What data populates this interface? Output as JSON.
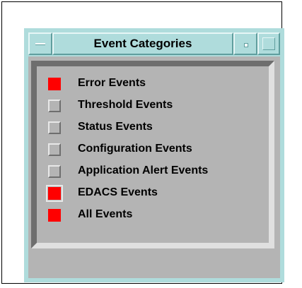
{
  "window": {
    "title": "Event Categories"
  },
  "categories": [
    {
      "label": "Error Events",
      "checked": true
    },
    {
      "label": "Threshold Events",
      "checked": false
    },
    {
      "label": "Status Events",
      "checked": false
    },
    {
      "label": "Configuration Events",
      "checked": false
    },
    {
      "label": "Application Alert Events",
      "checked": false
    },
    {
      "label": "EDACS Events",
      "checked": true
    },
    {
      "label": "All Events",
      "checked": true
    }
  ],
  "colors": {
    "titlebar": "#afdcdc",
    "panel": "#b4b4b4",
    "checked": "#ff0000"
  }
}
